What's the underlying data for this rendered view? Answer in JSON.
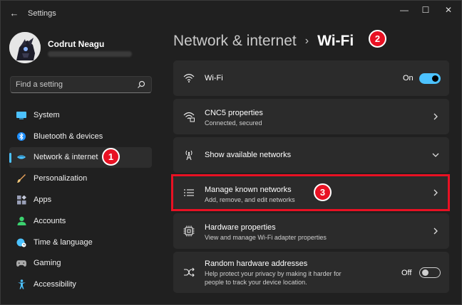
{
  "window": {
    "app_title": "Settings",
    "back": "←",
    "minimize": "—",
    "maximize": "☐",
    "close": "✕"
  },
  "profile": {
    "name": "Codrut Neagu"
  },
  "search": {
    "placeholder": "Find a setting"
  },
  "sidebar": {
    "items": [
      {
        "label": "System",
        "icon": "system-icon",
        "color": "#4cc2ff"
      },
      {
        "label": "Bluetooth & devices",
        "icon": "bluetooth-icon",
        "color": "#4cc2ff"
      },
      {
        "label": "Network & internet",
        "icon": "network-icon",
        "color": "#4cc2ff",
        "active": true
      },
      {
        "label": "Personalization",
        "icon": "brush-icon",
        "color": "#e8a25a"
      },
      {
        "label": "Apps",
        "icon": "apps-icon",
        "color": "#9aa0b8"
      },
      {
        "label": "Accounts",
        "icon": "accounts-icon",
        "color": "#3bd16f"
      },
      {
        "label": "Time & language",
        "icon": "time-language-icon",
        "color": "#4cc2ff"
      },
      {
        "label": "Gaming",
        "icon": "gaming-icon",
        "color": "#aaaaaa"
      },
      {
        "label": "Accessibility",
        "icon": "accessibility-icon",
        "color": "#4cc2ff"
      }
    ]
  },
  "breadcrumb": {
    "parent": "Network & internet",
    "separator": "›",
    "current": "Wi-Fi"
  },
  "cards": {
    "wifi": {
      "title": "Wi-Fi",
      "toggle_label": "On",
      "toggle_state": "on"
    },
    "properties": {
      "title": "CNC5 properties",
      "subtitle": "Connected, secured"
    },
    "available": {
      "title": "Show available networks"
    },
    "manage": {
      "title": "Manage known networks",
      "subtitle": "Add, remove, and edit networks"
    },
    "hardware": {
      "title": "Hardware properties",
      "subtitle": "View and manage Wi-Fi adapter properties"
    },
    "random": {
      "title": "Random hardware addresses",
      "subtitle_line1": "Help protect your privacy by making it harder for",
      "subtitle_line2": "people to track your device location.",
      "toggle_label": "Off",
      "toggle_state": "off"
    }
  },
  "annotations": {
    "badge1": "1",
    "badge2": "2",
    "badge3": "3",
    "highlight_color": "#e81123"
  },
  "accent_color": "#4cc2ff"
}
